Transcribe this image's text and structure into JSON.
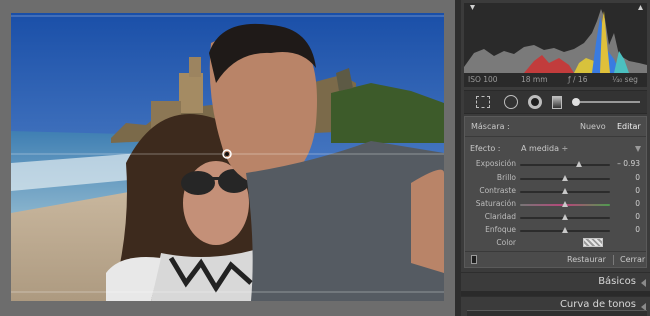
{
  "histogram": {
    "iso": "ISO 100",
    "focal": "18 mm",
    "aperture": "ƒ / 16",
    "shutter": "¹⁄₄₀ seg"
  },
  "mask": {
    "label": "Máscara :",
    "new_label": "Nuevo",
    "edit_label": "Editar"
  },
  "effect": {
    "label": "Efecto :",
    "value": "A medida ÷"
  },
  "sliders": [
    {
      "label": "Exposición",
      "value": "– 0.93",
      "level": -0.93
    },
    {
      "label": "Brillo",
      "value": "0",
      "level": 0
    },
    {
      "label": "Contraste",
      "value": "0",
      "level": 0
    },
    {
      "label": "Saturación",
      "value": "0",
      "level": 0
    },
    {
      "label": "Claridad",
      "value": "0",
      "level": 0
    },
    {
      "label": "Enfoque",
      "value": "0",
      "level": 0
    }
  ],
  "color_label": "Color",
  "footer": {
    "reset_label": "Restaurar",
    "close_label": "Cerrar"
  },
  "sections": {
    "basic": "Básicos",
    "tone_curve": "Curva de tonos"
  }
}
